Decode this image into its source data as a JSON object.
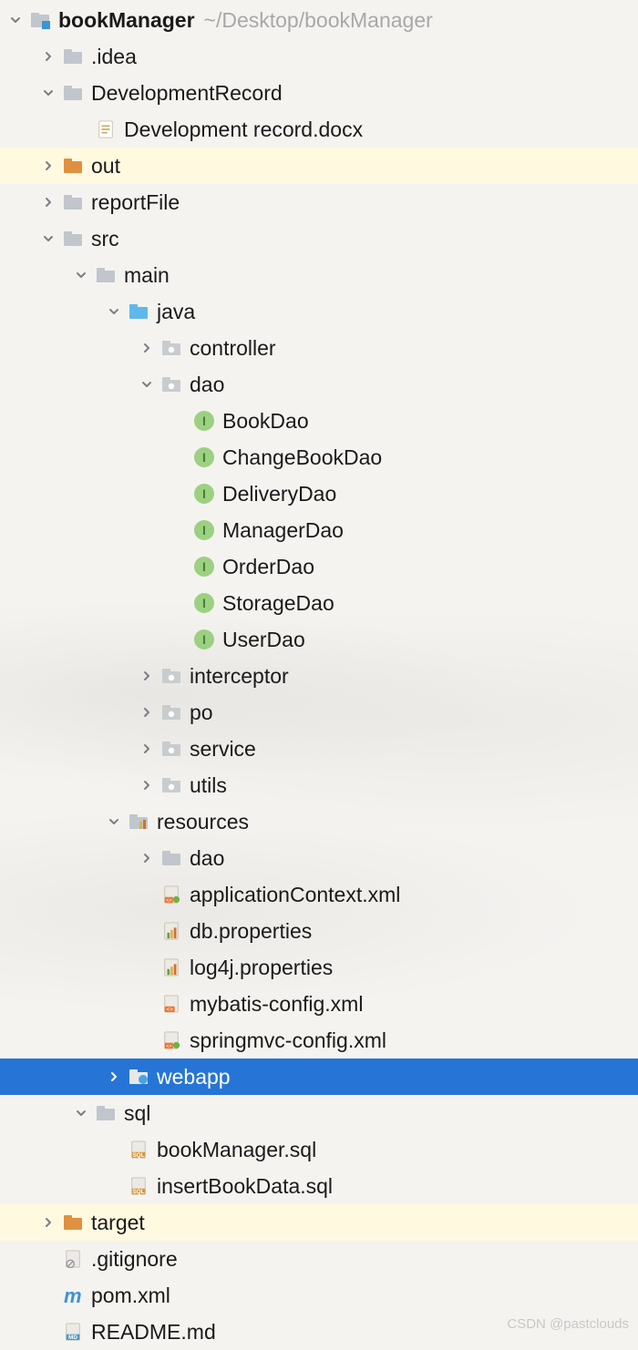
{
  "watermark": "CSDN @pastclouds",
  "tree": [
    {
      "depth": 0,
      "arrow": "open",
      "icon": "module",
      "label": "bookManager",
      "bold": true,
      "suffix": "~/Desktop/bookManager"
    },
    {
      "depth": 1,
      "arrow": "closed",
      "icon": "folder",
      "label": ".idea"
    },
    {
      "depth": 1,
      "arrow": "open",
      "icon": "folder",
      "label": "DevelopmentRecord"
    },
    {
      "depth": 2,
      "arrow": "none",
      "icon": "docx",
      "label": "Development record.docx"
    },
    {
      "depth": 1,
      "arrow": "closed",
      "icon": "folder-orange",
      "label": "out",
      "rowClass": "highlight-out"
    },
    {
      "depth": 1,
      "arrow": "closed",
      "icon": "folder",
      "label": "reportFile"
    },
    {
      "depth": 1,
      "arrow": "open",
      "icon": "folder",
      "label": "src"
    },
    {
      "depth": 2,
      "arrow": "open",
      "icon": "folder",
      "label": "main"
    },
    {
      "depth": 3,
      "arrow": "open",
      "icon": "folder-source",
      "label": "java"
    },
    {
      "depth": 4,
      "arrow": "closed",
      "icon": "package",
      "label": "controller"
    },
    {
      "depth": 4,
      "arrow": "open",
      "icon": "package",
      "label": "dao"
    },
    {
      "depth": 5,
      "arrow": "none",
      "icon": "interface",
      "label": "BookDao"
    },
    {
      "depth": 5,
      "arrow": "none",
      "icon": "interface",
      "label": "ChangeBookDao"
    },
    {
      "depth": 5,
      "arrow": "none",
      "icon": "interface",
      "label": "DeliveryDao"
    },
    {
      "depth": 5,
      "arrow": "none",
      "icon": "interface",
      "label": "ManagerDao"
    },
    {
      "depth": 5,
      "arrow": "none",
      "icon": "interface",
      "label": "OrderDao"
    },
    {
      "depth": 5,
      "arrow": "none",
      "icon": "interface",
      "label": "StorageDao"
    },
    {
      "depth": 5,
      "arrow": "none",
      "icon": "interface",
      "label": "UserDao"
    },
    {
      "depth": 4,
      "arrow": "closed",
      "icon": "package",
      "label": "interceptor"
    },
    {
      "depth": 4,
      "arrow": "closed",
      "icon": "package",
      "label": "po"
    },
    {
      "depth": 4,
      "arrow": "closed",
      "icon": "package",
      "label": "service"
    },
    {
      "depth": 4,
      "arrow": "closed",
      "icon": "package",
      "label": "utils"
    },
    {
      "depth": 3,
      "arrow": "open",
      "icon": "folder-resources",
      "label": "resources"
    },
    {
      "depth": 4,
      "arrow": "closed",
      "icon": "folder",
      "label": "dao"
    },
    {
      "depth": 4,
      "arrow": "none",
      "icon": "spring-xml",
      "label": "applicationContext.xml"
    },
    {
      "depth": 4,
      "arrow": "none",
      "icon": "properties",
      "label": "db.properties"
    },
    {
      "depth": 4,
      "arrow": "none",
      "icon": "properties",
      "label": "log4j.properties"
    },
    {
      "depth": 4,
      "arrow": "none",
      "icon": "xml",
      "label": "mybatis-config.xml"
    },
    {
      "depth": 4,
      "arrow": "none",
      "icon": "spring-xml",
      "label": "springmvc-config.xml"
    },
    {
      "depth": 3,
      "arrow": "closed",
      "icon": "folder-web",
      "label": "webapp",
      "rowClass": "selected"
    },
    {
      "depth": 2,
      "arrow": "open",
      "icon": "folder",
      "label": "sql"
    },
    {
      "depth": 3,
      "arrow": "none",
      "icon": "sql",
      "label": "bookManager.sql"
    },
    {
      "depth": 3,
      "arrow": "none",
      "icon": "sql",
      "label": "insertBookData.sql"
    },
    {
      "depth": 1,
      "arrow": "closed",
      "icon": "folder-orange",
      "label": "target",
      "rowClass": "highlight-target"
    },
    {
      "depth": 1,
      "arrow": "none",
      "icon": "gitignore",
      "label": ".gitignore"
    },
    {
      "depth": 1,
      "arrow": "none",
      "icon": "maven",
      "label": "pom.xml"
    },
    {
      "depth": 1,
      "arrow": "none",
      "icon": "md",
      "label": "README.md"
    }
  ]
}
